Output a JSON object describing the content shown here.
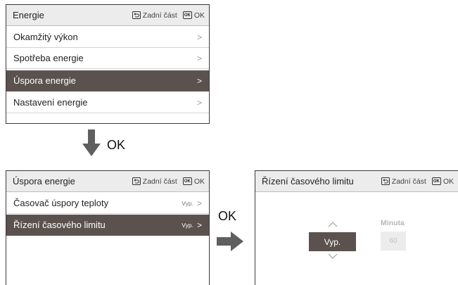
{
  "screen1": {
    "title": "Energie",
    "back_label": "Zadní část",
    "ok_key": "OK",
    "ok_label": "OK",
    "items": [
      {
        "label": "Okamžitý výkon",
        "chevron": ">"
      },
      {
        "label": "Spotřeba energie",
        "chevron": ">"
      },
      {
        "label": "Úspora energie",
        "chevron": ">",
        "selected": true
      },
      {
        "label": "Nastavení energie",
        "chevron": ">"
      }
    ]
  },
  "transition1": {
    "label": "OK"
  },
  "screen2": {
    "title": "Úspora energie",
    "back_label": "Zadní část",
    "ok_key": "OK",
    "ok_label": "OK",
    "items": [
      {
        "label": "Časovač úspory teploty",
        "value": "Vyp.",
        "chevron": ">"
      },
      {
        "label": "Řízení časového limitu",
        "value": "Vyp.",
        "chevron": ">",
        "selected": true
      }
    ]
  },
  "transition2": {
    "label": "OK"
  },
  "screen3": {
    "title": "Řízení časového limitu",
    "back_label": "Zadní část",
    "ok_key": "OK",
    "ok_label": "OK",
    "spinner_value": "Vyp.",
    "minute_label": "Minuta",
    "minute_value": "60"
  },
  "colors": {
    "header_bg": "#ececec",
    "selected_bg": "#5b5250",
    "border": "#3a3a3a",
    "arrow": "#5f5f5f"
  },
  "icons": [
    "back-icon",
    "ok-key-icon",
    "chevron-right-icon",
    "arrow-down-icon",
    "arrow-right-icon",
    "chevron-up-icon",
    "chevron-down-icon"
  ]
}
